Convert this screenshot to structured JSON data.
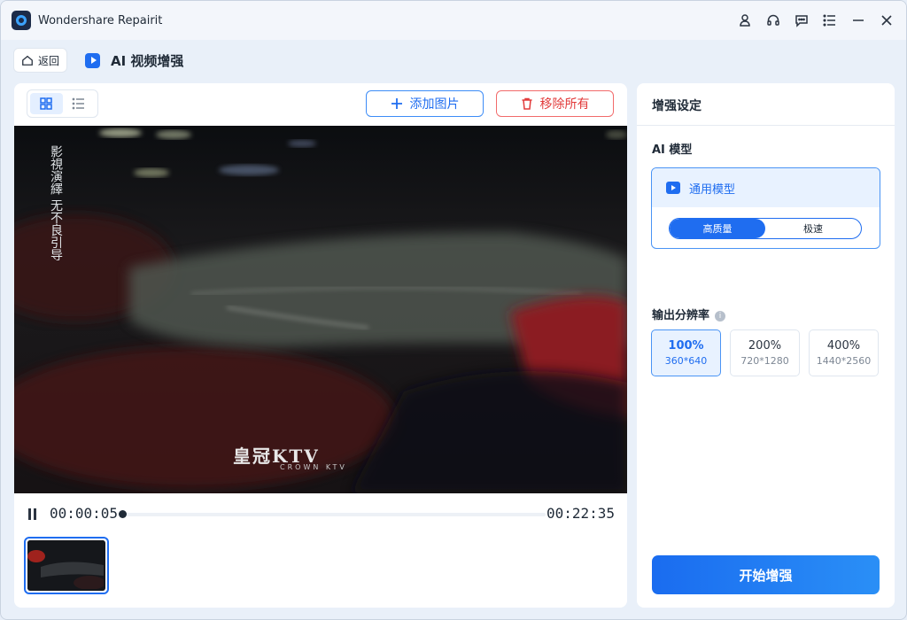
{
  "window": {
    "app_title": "Wondershare Repairit",
    "controls": [
      "user-icon",
      "headset-icon",
      "chat-icon",
      "menu-icon",
      "minimize-icon",
      "close-icon"
    ]
  },
  "subheader": {
    "back_label": "返回",
    "page_title": "AI 视频增强"
  },
  "toolbar": {
    "add_label": "添加图片",
    "remove_label": "移除所有"
  },
  "video": {
    "vertical_caption": "影視演繹 无不良引导",
    "logo_text": "皇冠KTV",
    "logo_sub": "CROWN KTV"
  },
  "player": {
    "current_time": "00:00:05",
    "total_time": "00:22:35",
    "progress": 0.0
  },
  "settings": {
    "title": "增强设定",
    "ai_model_label": "AI 模型",
    "model_name": "通用模型",
    "modes": [
      "高质量",
      "极速"
    ],
    "selected_mode": "高质量",
    "resolution_label": "输出分辨率",
    "resolutions": [
      {
        "percent": "100%",
        "dims": "360*640",
        "selected": true
      },
      {
        "percent": "200%",
        "dims": "720*1280",
        "selected": false
      },
      {
        "percent": "400%",
        "dims": "1440*2560",
        "selected": false
      }
    ],
    "start_label": "开始增强"
  },
  "colors": {
    "accent": "#1f6df0",
    "danger": "#e23b3b",
    "window_bg": "#e9f0f9"
  }
}
